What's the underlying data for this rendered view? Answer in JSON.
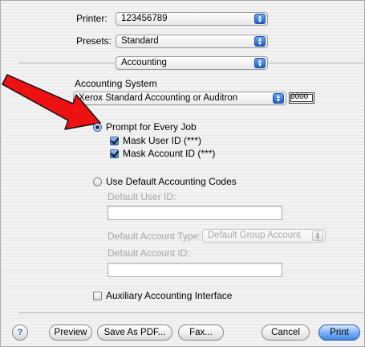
{
  "printer": {
    "label": "Printer:",
    "value": "123456789"
  },
  "presets": {
    "label": "Presets:",
    "value": "Standard"
  },
  "panel": {
    "value": "Accounting"
  },
  "accounting_system": {
    "heading": "Accounting System",
    "value": "Xerox Standard Accounting or Auditron",
    "counter": "0000"
  },
  "options": {
    "prompt_label": "Prompt for Every Job",
    "mask_user_label": "Mask User ID (***)",
    "mask_account_label": "Mask Account ID (***)",
    "use_default_label": "Use Default Accounting Codes",
    "default_user_label": "Default User ID:",
    "default_account_type_label": "Default Account Type:",
    "default_account_type_value": "Default Group Account",
    "default_account_id_label": "Default Account ID:",
    "auxiliary_label": "Auxiliary Accounting Interface",
    "prompt_selected": true,
    "mask_user_checked": true,
    "mask_account_checked": true,
    "auxiliary_checked": false
  },
  "buttons": {
    "help": "?",
    "preview": "Preview",
    "save_pdf": "Save As PDF...",
    "fax": "Fax...",
    "cancel": "Cancel",
    "print": "Print"
  },
  "colors": {
    "annotation_arrow": "#ee1111",
    "default_button": "#3f86e6"
  }
}
